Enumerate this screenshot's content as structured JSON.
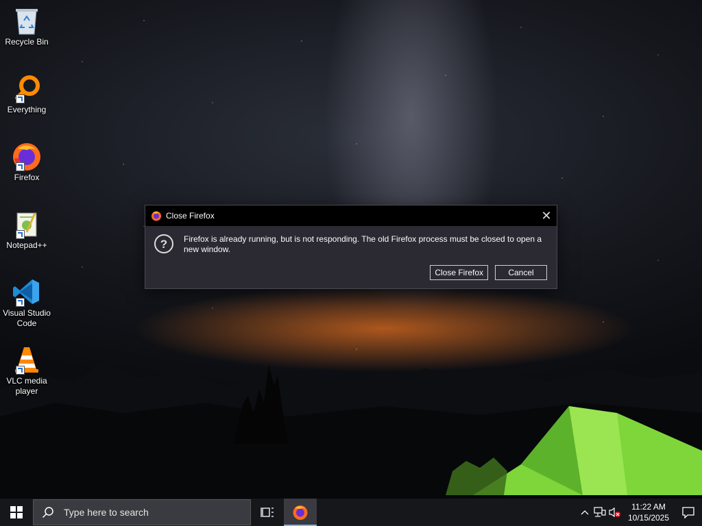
{
  "desktop": {
    "icons": [
      {
        "label": "Recycle Bin",
        "icon": "recycle-bin-icon"
      },
      {
        "label": "Everything",
        "icon": "everything-search-icon"
      },
      {
        "label": "Firefox",
        "icon": "firefox-icon"
      },
      {
        "label": "Notepad++",
        "icon": "notepad-plus-plus-icon"
      },
      {
        "label": "Visual Studio Code",
        "icon": "vscode-icon"
      },
      {
        "label": "VLC media player",
        "icon": "vlc-icon"
      }
    ]
  },
  "dialog": {
    "title": "Close Firefox",
    "message": "Firefox is already running, but is not responding. The old Firefox process must be closed to open a new window.",
    "close_button": "Close Firefox",
    "cancel_button": "Cancel"
  },
  "taskbar": {
    "search_placeholder": "Type here to search",
    "clock_time": "11:22 AM",
    "clock_date": "10/15/2025"
  },
  "colors": {
    "taskbar_bg": "#16171b",
    "dialog_bg": "#2b2a33",
    "titlebar_bg": "#000000",
    "accent": "#76b9ed"
  }
}
